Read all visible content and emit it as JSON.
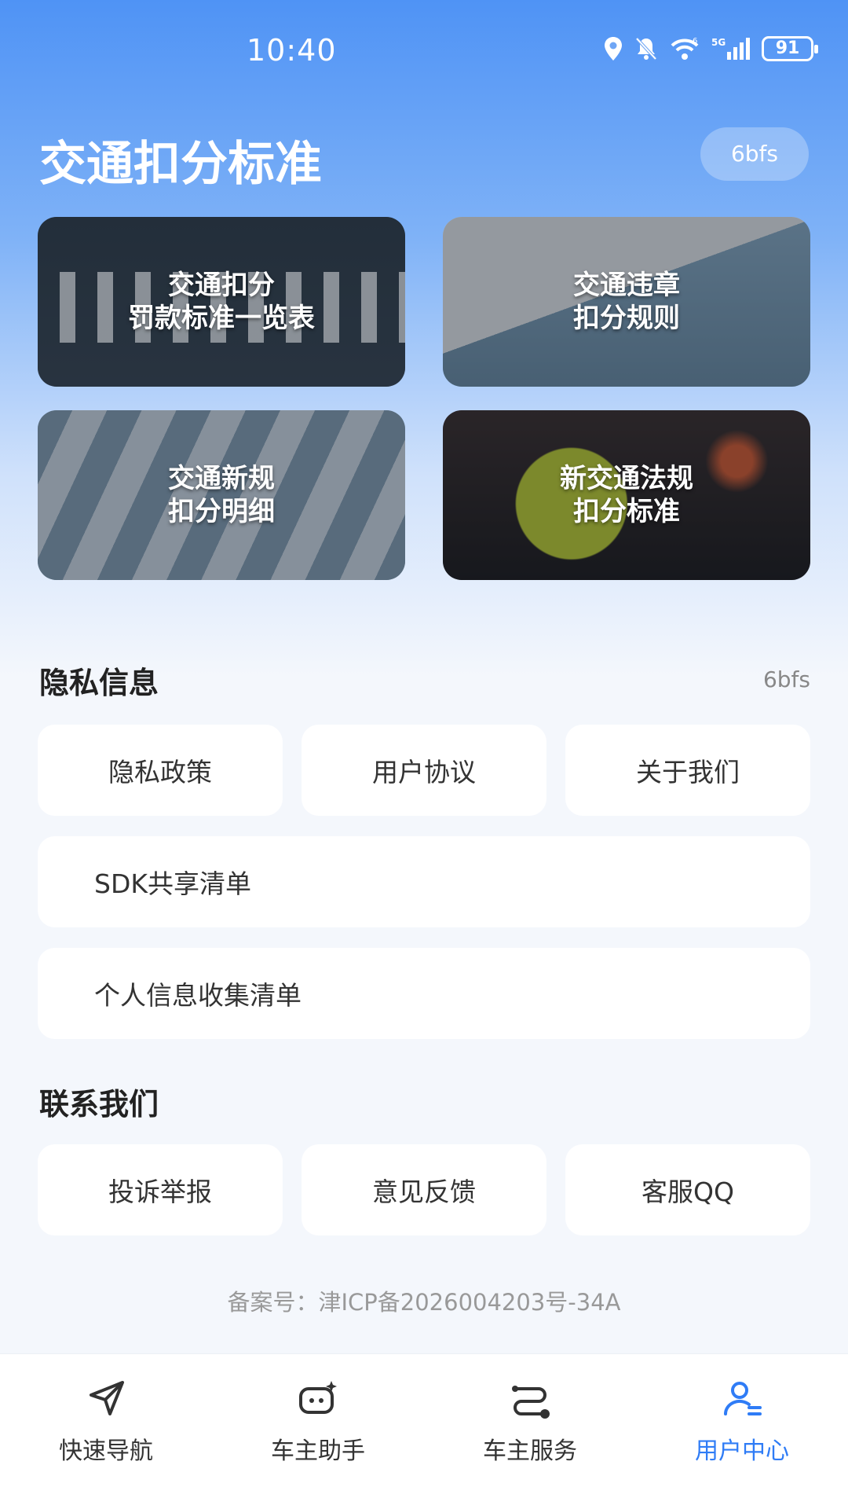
{
  "status_bar": {
    "time": "10:40",
    "battery": "91",
    "icons": [
      "location-icon",
      "mute-bell-icon",
      "wifi-icon",
      "signal-5g-icon",
      "battery-icon"
    ]
  },
  "header": {
    "title": "交通扣分标准",
    "pill": "6bfs"
  },
  "cards": [
    {
      "line1": "交通扣分",
      "line2": "罚款标准一览表"
    },
    {
      "line1": "交通违章",
      "line2": "扣分规则"
    },
    {
      "line1": "交通新规",
      "line2": "扣分明细"
    },
    {
      "line1": "新交通法规",
      "line2": "扣分标准"
    }
  ],
  "privacy": {
    "title": "隐私信息",
    "side": "6bfs",
    "buttons": [
      "隐私政策",
      "用户协议",
      "关于我们"
    ],
    "sdk": "SDK共享清单",
    "personal": "个人信息收集清单"
  },
  "contact": {
    "title": "联系我们",
    "buttons": [
      "投诉举报",
      "意见反馈",
      "客服QQ"
    ]
  },
  "icp": "备案号：津ICP备2026004203号-34A",
  "tabs": [
    {
      "label": "快速导航",
      "icon": "navigation-arrow-icon"
    },
    {
      "label": "车主助手",
      "icon": "assistant-icon"
    },
    {
      "label": "车主服务",
      "icon": "route-service-icon"
    },
    {
      "label": "用户中心",
      "icon": "user-center-icon"
    }
  ],
  "colors": {
    "accent": "#2f7cf6",
    "header_blue": "#4f93f5"
  }
}
